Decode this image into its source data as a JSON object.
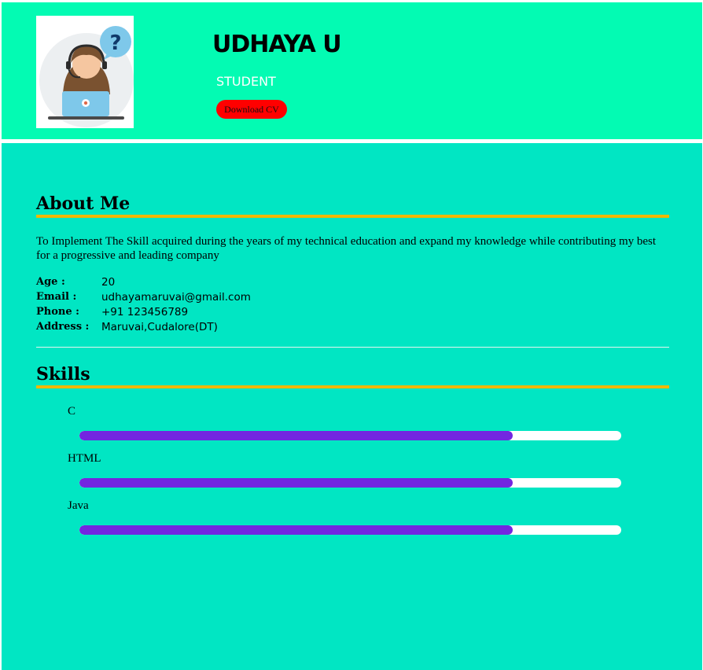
{
  "header": {
    "name": "UDHAYA U",
    "role": "STUDENT",
    "cv_button": "Download CV"
  },
  "about": {
    "title": "About Me",
    "text": "To Implement The Skill acquired during the years of my technical education and expand my knowledge while contributing my best for a progressive and leading company",
    "info": [
      {
        "label": "Age :",
        "value": "20"
      },
      {
        "label": "Email :",
        "value": "udhayamaruvai@gmail.com"
      },
      {
        "label": "Phone :",
        "value": "+91 123456789"
      },
      {
        "label": "Address :",
        "value": "Maruvai,Cudalore(DT)"
      }
    ]
  },
  "skills": {
    "title": "Skills",
    "items": [
      {
        "name": "C",
        "level_percent": 80
      },
      {
        "name": "HTML",
        "level_percent": 80
      },
      {
        "name": "Java",
        "level_percent": 80
      }
    ]
  },
  "colors": {
    "header_bg": "#03fbb3",
    "main_bg": "#01e6c3",
    "accent_rule": "#f0b800",
    "skill_fill": "#7326e0",
    "button_bg": "#ff0000"
  }
}
